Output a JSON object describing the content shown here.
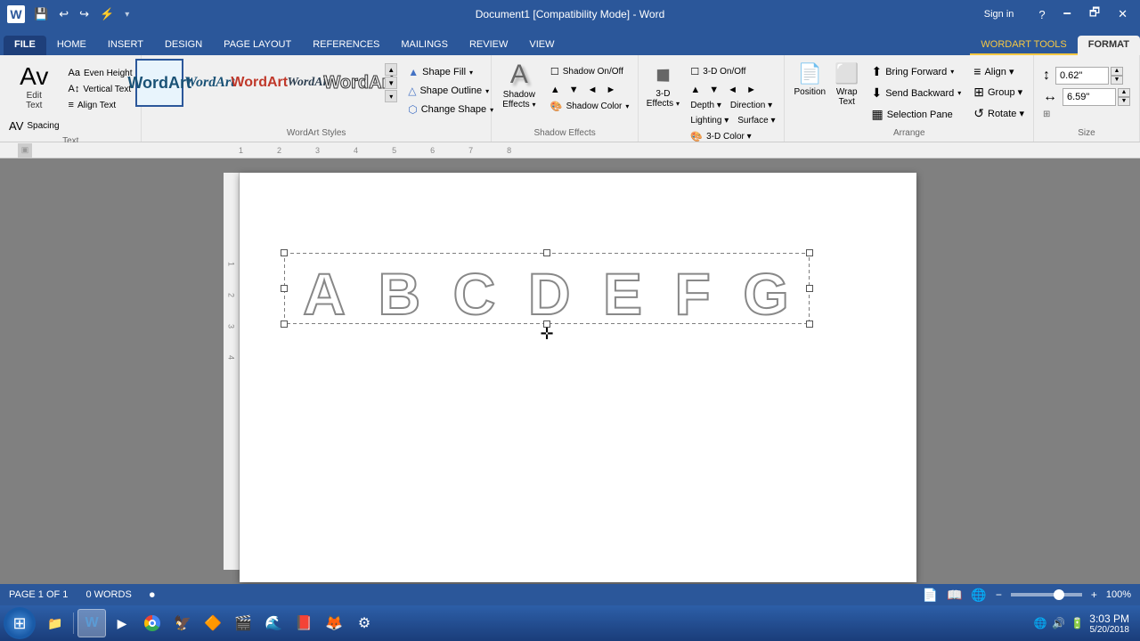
{
  "titlebar": {
    "title": "Document1 [Compatibility Mode] - Word",
    "wordart_tools": "WORDART TOOLS",
    "sign_in": "Sign in",
    "quick_access": [
      "💾",
      "↩",
      "↪",
      "⚡"
    ],
    "window_controls": [
      "?",
      "🗕",
      "🗗",
      "✕"
    ]
  },
  "ribbon_tabs": [
    {
      "label": "FILE",
      "id": "file",
      "active": false,
      "is_file": true
    },
    {
      "label": "HOME",
      "id": "home",
      "active": false
    },
    {
      "label": "INSERT",
      "id": "insert",
      "active": false
    },
    {
      "label": "DESIGN",
      "id": "design",
      "active": false
    },
    {
      "label": "PAGE LAYOUT",
      "id": "page-layout",
      "active": false
    },
    {
      "label": "REFERENCES",
      "id": "references",
      "active": false
    },
    {
      "label": "MAILINGS",
      "id": "mailings",
      "active": false
    },
    {
      "label": "REVIEW",
      "id": "review",
      "active": false
    },
    {
      "label": "VIEW",
      "id": "view",
      "active": false
    },
    {
      "label": "FORMAT",
      "id": "format",
      "active": true
    }
  ],
  "ribbon": {
    "text_group": {
      "label": "Text",
      "edit_text": "Edit\nText",
      "spacing": "Spacing",
      "even_height": "Even\nHeight",
      "vertical": "Vertical\nText",
      "align": "Align\nText"
    },
    "wordart_styles_group": {
      "label": "WordArt Styles",
      "shape_fill": "Shape Fill",
      "shape_outline": "Shape Outline",
      "change_shape": "Change Shape",
      "samples": [
        {
          "id": 1,
          "text": "WordArt",
          "class": "wa1",
          "selected": true
        },
        {
          "id": 2,
          "text": "WordArt",
          "class": "wa2"
        },
        {
          "id": 3,
          "text": "WordArt",
          "class": "wa3"
        },
        {
          "id": 4,
          "text": "WordArt",
          "class": "wa4"
        },
        {
          "id": 5,
          "text": "WordArt",
          "class": "wa5"
        }
      ]
    },
    "shadow_effects_group": {
      "label": "Shadow Effects",
      "shadow_effects": "Shadow\nEffects"
    },
    "threed_group": {
      "label": "3-D Effects",
      "threed_effects": "3-D\nEffects"
    },
    "arrange_group": {
      "label": "Arrange",
      "position": "Position",
      "wrap_text": "Wrap\nText",
      "bring_forward": "Bring Forward",
      "send_backward": "Send Backward",
      "selection_pane": "Selection Pane",
      "rotate": "Rotate",
      "align": "Align",
      "group": "Group"
    },
    "size_group": {
      "label": "Size",
      "height_label": "Height",
      "width_label": "Width",
      "height_value": "0.62\"",
      "width_value": "6.59\""
    }
  },
  "document": {
    "letters": [
      "A",
      "B",
      "C",
      "D",
      "E",
      "F",
      "G"
    ]
  },
  "statusbar": {
    "page_info": "PAGE 1 OF 1",
    "words": "0 WORDS",
    "zoom": "100%",
    "zoom_value": 100
  },
  "taskbar": {
    "start_icon": "⊞",
    "datetime": "3:03 PM",
    "date": "5/20/2018",
    "apps": [
      {
        "icon": "📁",
        "name": "file-explorer"
      },
      {
        "icon": "W",
        "name": "word-app",
        "active": true
      },
      {
        "icon": "⏵",
        "name": "media-player"
      },
      {
        "icon": "🌐",
        "name": "chrome"
      },
      {
        "icon": "🦅",
        "name": "app5"
      },
      {
        "icon": "⏵",
        "name": "vlc"
      },
      {
        "icon": "🎬",
        "name": "video-app"
      },
      {
        "icon": "🌊",
        "name": "browser"
      },
      {
        "icon": "📄",
        "name": "pdf-reader"
      },
      {
        "icon": "🦊",
        "name": "firefox"
      },
      {
        "icon": "⚙",
        "name": "system-app"
      }
    ]
  }
}
